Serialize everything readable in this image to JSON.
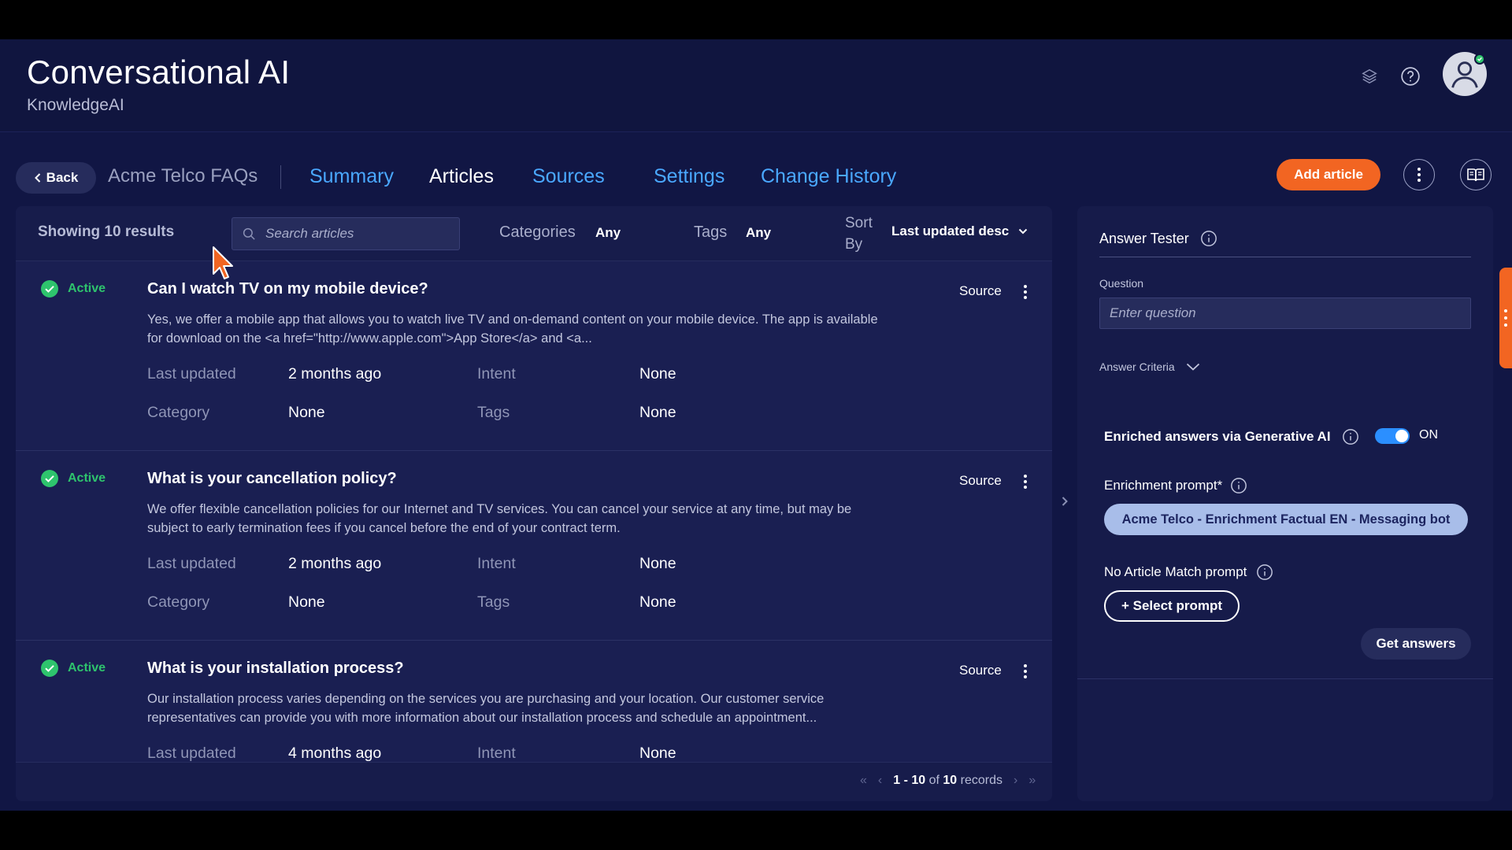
{
  "header": {
    "title": "Conversational AI",
    "subtitle": "KnowledgeAI",
    "icons": [
      "layers-icon",
      "help-icon",
      "user-avatar-icon"
    ]
  },
  "nav": {
    "back_label": "Back",
    "breadcrumb": "Acme Telco FAQs",
    "tabs": [
      {
        "label": "Summary",
        "active": false
      },
      {
        "label": "Articles",
        "active": true
      },
      {
        "label": "Sources",
        "active": false
      },
      {
        "label": "Settings",
        "active": false
      },
      {
        "label": "Change History",
        "active": false
      }
    ],
    "add_article_label": "Add article"
  },
  "filters": {
    "showing": "Showing 10 results",
    "search_placeholder": "Search articles",
    "categories_label": "Categories",
    "categories_value": "Any",
    "tags_label": "Tags",
    "tags_value": "Any",
    "sort_label": "Sort By",
    "sort_value": "Last updated desc"
  },
  "articles": [
    {
      "status": "Active",
      "title": "Can I watch TV on my mobile device?",
      "body": "Yes, we offer a mobile app that allows you to watch live TV and on-demand content on your mobile device. The app is available for download on the <a href=\"http://www.apple.com\">App Store</a> and <a...",
      "source_label": "Source",
      "last_updated_label": "Last updated",
      "last_updated": "2 months ago",
      "intent_label": "Intent",
      "intent": "None",
      "category_label": "Category",
      "category": "None",
      "tags_label": "Tags",
      "tags": "None"
    },
    {
      "status": "Active",
      "title": "What is your cancellation policy?",
      "body": "We offer flexible cancellation policies for our Internet and TV services. You can cancel your service at any time, but may be subject to early termination fees if you cancel before the end of your contract term.",
      "source_label": "Source",
      "last_updated_label": "Last updated",
      "last_updated": "2 months ago",
      "intent_label": "Intent",
      "intent": "None",
      "category_label": "Category",
      "category": "None",
      "tags_label": "Tags",
      "tags": "None"
    },
    {
      "status": "Active",
      "title": "What is your installation process?",
      "body": "Our installation process varies depending on the services you are purchasing and your location. Our customer service representatives can provide you with more information about our installation process and schedule an appointment...",
      "source_label": "Source",
      "last_updated_label": "Last updated",
      "last_updated": "4 months ago",
      "intent_label": "Intent",
      "intent": "None"
    }
  ],
  "pager": {
    "range": "1 - 10",
    "of": "of",
    "total": "10",
    "unit": "records"
  },
  "answer_tester": {
    "title": "Answer Tester",
    "question_label": "Question",
    "question_placeholder": "Enter question",
    "criteria_label": "Answer Criteria",
    "enriched_label": "Enriched answers via Generative AI",
    "toggle_state": "ON",
    "enrichment_label": "Enrichment prompt*",
    "enrichment_value": "Acme Telco - Enrichment Factual EN - Messaging bot",
    "no_match_label": "No Article Match prompt",
    "select_prompt_label": "+ Select prompt",
    "get_answers_label": "Get answers"
  },
  "colors": {
    "background": "#111644",
    "panel": "#1a1f52",
    "accent_orange": "#f26522",
    "link_blue": "#4aa8ff",
    "active_green": "#2ec46d",
    "chip_blue": "#a8bde9"
  }
}
